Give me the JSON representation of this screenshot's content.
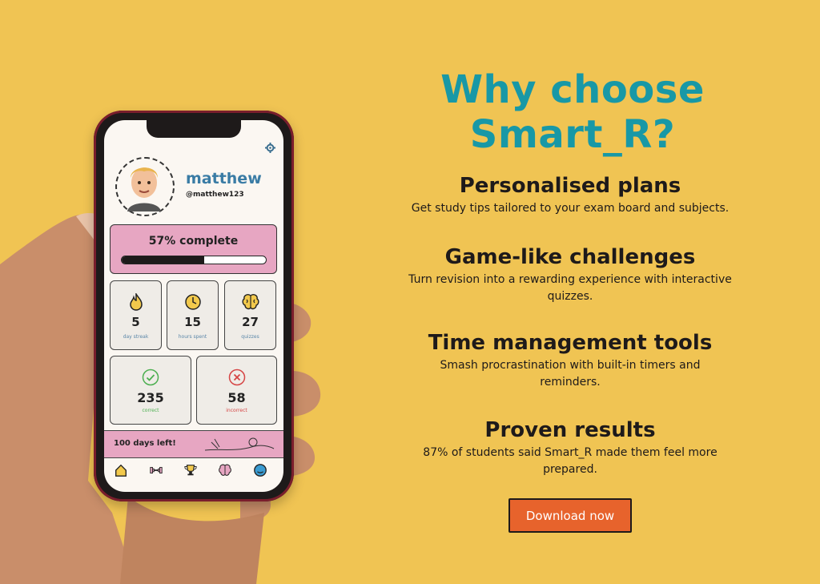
{
  "colors": {
    "background": "#F0C453",
    "headline": "#1898A6",
    "card_pink": "#E7A6C2",
    "cta": "#E7632C",
    "username": "#3A7CA5",
    "correct_green": "#4CAF50",
    "incorrect_red": "#D64545"
  },
  "page": {
    "headline": "Why choose Smart_R?",
    "features": [
      {
        "title": "Personalised plans",
        "text": "Get study tips tailored to your exam board and subjects."
      },
      {
        "title": "Game-like challenges",
        "text": "Turn revision into a rewarding experience with interactive quizzes."
      },
      {
        "title": "Time management tools",
        "text": "Smash procrastination with built-in timers and reminders."
      },
      {
        "title": "Proven results",
        "text": "87% of students said Smart_R made them feel more prepared."
      }
    ],
    "cta_label": "Download now"
  },
  "phone": {
    "profile": {
      "name": "matthew",
      "handle": "@matthew123"
    },
    "progress": {
      "label": "57% complete",
      "fraction": 0.57
    },
    "stats": [
      {
        "icon": "flame-icon",
        "value": "5",
        "label": "day streak"
      },
      {
        "icon": "clock-icon",
        "value": "15",
        "label": "hours spent"
      },
      {
        "icon": "brain-icon",
        "value": "27",
        "label": "quizzes"
      }
    ],
    "results": [
      {
        "icon": "check-circle-icon",
        "value": "235",
        "label": "correct"
      },
      {
        "icon": "x-circle-icon",
        "value": "58",
        "label": "incorrect"
      }
    ],
    "countdown": "100 days left!",
    "nav": [
      "home-icon",
      "dumbbell-icon",
      "trophy-icon",
      "brain-icon",
      "profile-icon"
    ]
  }
}
